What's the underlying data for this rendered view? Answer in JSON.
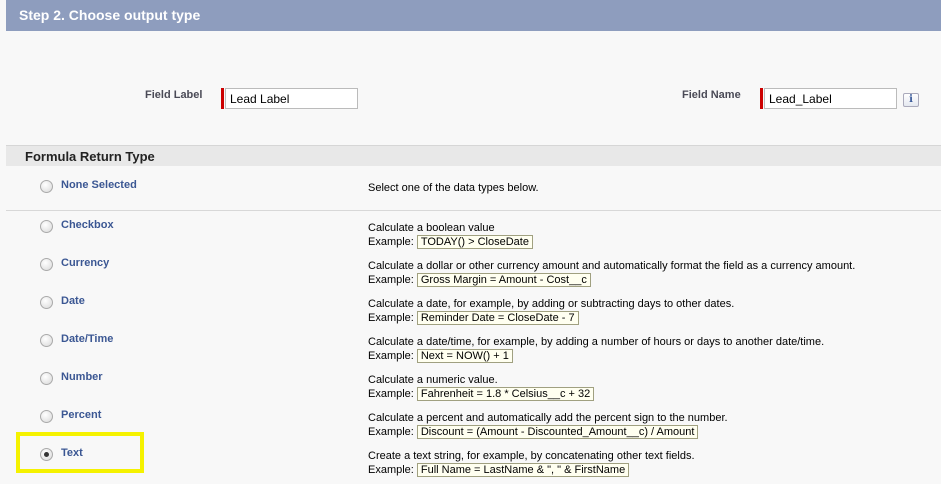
{
  "step_title": "Step 2. Choose output type",
  "fields": {
    "field_label": {
      "label": "Field Label",
      "value": "Lead Label"
    },
    "field_name": {
      "label": "Field Name",
      "value": "Lead_Label",
      "info_icon": "i"
    }
  },
  "section_title": "Formula Return Type",
  "return_types": [
    {
      "name": "None Selected",
      "description": "Select one of the data types below.",
      "example_label": "",
      "example": "",
      "checked": false
    },
    {
      "name": "Checkbox",
      "description": "Calculate a boolean value",
      "example_label": "Example:",
      "example": "TODAY() > CloseDate",
      "checked": false
    },
    {
      "name": "Currency",
      "description": "Calculate a dollar or other currency amount and automatically format the field as a currency amount.",
      "example_label": "Example:",
      "example": "Gross Margin = Amount - Cost__c",
      "checked": false
    },
    {
      "name": "Date",
      "description": "Calculate a date, for example, by adding or subtracting days to other dates.",
      "example_label": "Example:",
      "example": "Reminder Date = CloseDate - 7",
      "checked": false
    },
    {
      "name": "Date/Time",
      "description": "Calculate a date/time, for example, by adding a number of hours or days to another date/time.",
      "example_label": "Example:",
      "example": "Next = NOW() + 1",
      "checked": false
    },
    {
      "name": "Number",
      "description": "Calculate a numeric value.",
      "example_label": "Example:",
      "example": "Fahrenheit = 1.8 * Celsius__c + 32",
      "checked": false
    },
    {
      "name": "Percent",
      "description": "Calculate a percent and automatically add the percent sign to the number.",
      "example_label": "Example:",
      "example": "Discount = (Amount - Discounted_Amount__c) / Amount",
      "checked": false
    },
    {
      "name": "Text",
      "description": "Create a text string, for example, by concatenating other text fields.",
      "example_label": "Example:",
      "example": "Full Name = LastName & \", \" & FirstName",
      "checked": true
    }
  ],
  "colors": {
    "header_bg": "#8e9dbe",
    "type_name": "#3b5793",
    "required_bar": "#cc0000",
    "highlight": "#f5f200"
  }
}
